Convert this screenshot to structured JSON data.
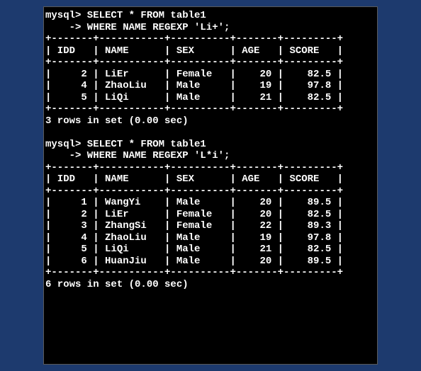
{
  "queries": [
    {
      "prompt1": "mysql> SELECT * FROM table1",
      "prompt2": "    -> WHERE NAME REGEXP 'Li+';",
      "columns": [
        "IDD",
        "NAME",
        "SEX",
        "AGE",
        "SCORE"
      ],
      "rows": [
        {
          "idd": "2",
          "name": "LiEr",
          "sex": "Female",
          "age": "20",
          "score": "82.5"
        },
        {
          "idd": "4",
          "name": "ZhaoLiu",
          "sex": "Male",
          "age": "19",
          "score": "97.8"
        },
        {
          "idd": "5",
          "name": "LiQi",
          "sex": "Male",
          "age": "21",
          "score": "82.5"
        }
      ],
      "status": "3 rows in set (0.00 sec)"
    },
    {
      "prompt1": "mysql> SELECT * FROM table1",
      "prompt2": "    -> WHERE NAME REGEXP 'L*i';",
      "columns": [
        "IDD",
        "NAME",
        "SEX",
        "AGE",
        "SCORE"
      ],
      "rows": [
        {
          "idd": "1",
          "name": "WangYi",
          "sex": "Male",
          "age": "20",
          "score": "89.5"
        },
        {
          "idd": "2",
          "name": "LiEr",
          "sex": "Female",
          "age": "20",
          "score": "82.5"
        },
        {
          "idd": "3",
          "name": "ZhangSi",
          "sex": "Female",
          "age": "22",
          "score": "89.3"
        },
        {
          "idd": "4",
          "name": "ZhaoLiu",
          "sex": "Male",
          "age": "19",
          "score": "97.8"
        },
        {
          "idd": "5",
          "name": "LiQi",
          "sex": "Male",
          "age": "21",
          "score": "82.5"
        },
        {
          "idd": "6",
          "name": "HuanJiu",
          "sex": "Male",
          "age": "20",
          "score": "89.5"
        }
      ],
      "status": "6 rows in set (0.00 sec)"
    }
  ],
  "widths": {
    "idd": 5,
    "name": 9,
    "sex": 8,
    "age": 5,
    "score": 7
  }
}
